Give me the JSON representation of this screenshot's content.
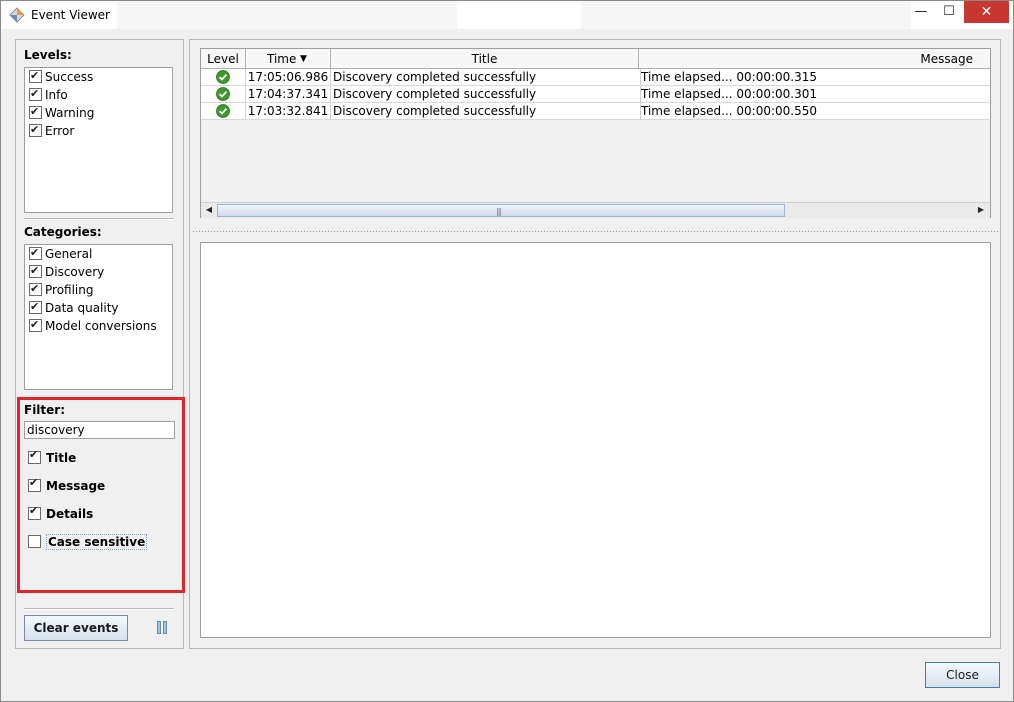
{
  "window": {
    "title": "Event Viewer",
    "controls": {
      "minimize": "—",
      "maximize": "☐",
      "close": "✕"
    }
  },
  "left": {
    "levels_label": "Levels:",
    "levels": [
      {
        "label": "Success",
        "checked": true
      },
      {
        "label": "Info",
        "checked": true
      },
      {
        "label": "Warning",
        "checked": true
      },
      {
        "label": "Error",
        "checked": true
      }
    ],
    "categories_label": "Categories:",
    "categories": [
      {
        "label": "General",
        "checked": true
      },
      {
        "label": "Discovery",
        "checked": true
      },
      {
        "label": "Profiling",
        "checked": true
      },
      {
        "label": "Data quality",
        "checked": true
      },
      {
        "label": "Model conversions",
        "checked": true
      }
    ],
    "filter": {
      "label": "Filter:",
      "value": "discovery",
      "options": [
        {
          "label": "Title",
          "checked": true
        },
        {
          "label": "Message",
          "checked": true
        },
        {
          "label": "Details",
          "checked": true
        },
        {
          "label": "Case sensitive",
          "checked": false
        }
      ]
    },
    "clear_button": "Clear events",
    "pause_icon": "pause-icon"
  },
  "table": {
    "columns": {
      "level": "Level",
      "time": "Time",
      "time_sort": "▼",
      "title": "Title",
      "message": "Message"
    },
    "rows": [
      {
        "level": "success",
        "time": "17:05:06.986",
        "title": "Discovery completed successfully",
        "message": "Time elapsed... 00:00:00.315"
      },
      {
        "level": "success",
        "time": "17:04:37.341",
        "title": "Discovery completed successfully",
        "message": "Time elapsed... 00:00:00.301"
      },
      {
        "level": "success",
        "time": "17:03:32.841",
        "title": "Discovery completed successfully",
        "message": "Time elapsed... 00:00:00.550"
      }
    ],
    "scroll_left": "◀",
    "scroll_right": "▶",
    "scroll_grip": "|||"
  },
  "footer": {
    "close_button": "Close"
  },
  "colors": {
    "highlight": "#e2252b",
    "success": "#3d9a2a",
    "close_btn": "#c7372f"
  }
}
